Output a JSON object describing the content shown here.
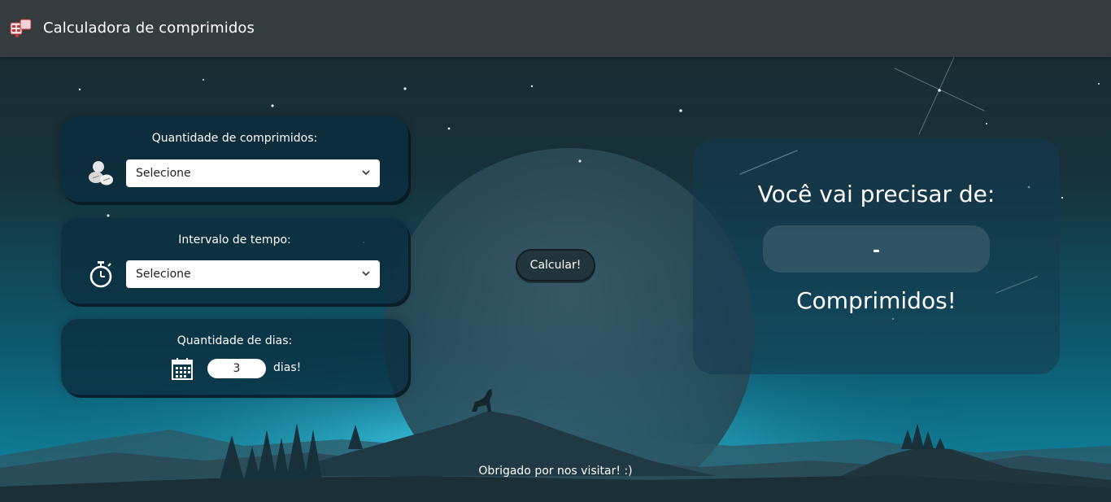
{
  "header": {
    "title": "Calculadora de comprimidos",
    "logo_icon": "pill-box-logo-icon"
  },
  "form": {
    "pills": {
      "label": "Quantidade de comprimidos:",
      "icon": "pills-icon",
      "selected": "Selecione"
    },
    "interval": {
      "label": "Intervalo de tempo:",
      "icon": "stopwatch-icon",
      "selected": "Selecione"
    },
    "days": {
      "label": "Quantidade de dias:",
      "icon": "calendar-icon",
      "value": "3",
      "unit": "dias!"
    },
    "calculate_label": "Calcular!"
  },
  "result": {
    "heading": "Você vai precisar de:",
    "value": "-",
    "unit": "Comprimidos!"
  },
  "footer": {
    "text": "Obrigado por nos visitar! :)"
  },
  "colors": {
    "navbar": "#343c40",
    "card": "#0a2d3e",
    "sky_top": "#172a2f",
    "glow": "#1aa3c4"
  }
}
